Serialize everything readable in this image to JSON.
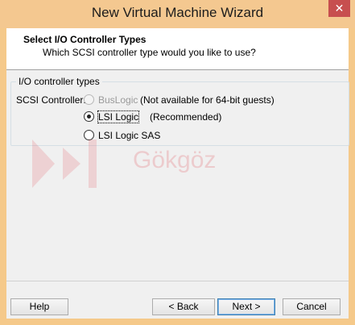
{
  "window": {
    "title": "New Virtual Machine Wizard",
    "close_glyph": "✕"
  },
  "header": {
    "title": "Select I/O Controller Types",
    "subtitle": "Which SCSI controller type would you like to use?"
  },
  "group": {
    "legend": "I/O controller types",
    "scsi_label": "SCSI Controller:",
    "options": [
      {
        "label": "BusLogic",
        "note": "(Not available for 64-bit guests)",
        "selected": false,
        "enabled": false
      },
      {
        "label": "LSI Logic",
        "note": "(Recommended)",
        "selected": true,
        "enabled": true
      },
      {
        "label": "LSI Logic SAS",
        "note": "",
        "selected": false,
        "enabled": true
      }
    ]
  },
  "watermark": {
    "text": "Gökgöz"
  },
  "buttons": {
    "help": "Help",
    "back": "< Back",
    "next": "Next >",
    "cancel": "Cancel"
  },
  "colors": {
    "titlebar": "#f4c890",
    "close": "#c74f4f",
    "default_button_border": "#3c7fb1"
  }
}
